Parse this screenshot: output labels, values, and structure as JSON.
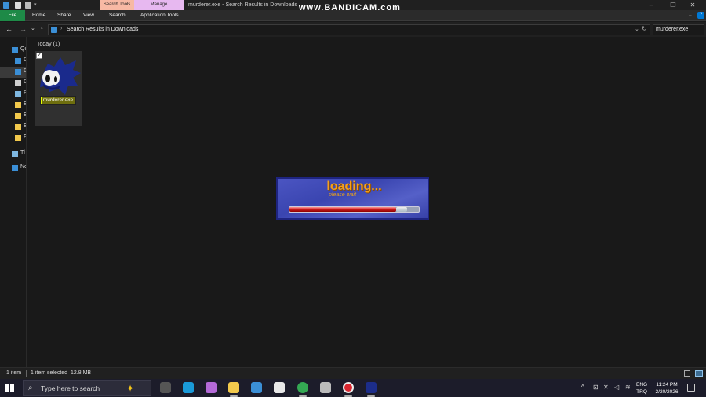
{
  "window": {
    "title": "murderer.exe - Search Results in Downloads",
    "context_tab_search": "Search Tools",
    "context_tab_manage": "Manage",
    "watermark": "www.BANDICAM.com",
    "minimize": "–",
    "maximize": "❐",
    "close": "✕"
  },
  "ribbon": {
    "file": "File",
    "tabs": [
      "Home",
      "Share",
      "View",
      "Search",
      "Application Tools"
    ],
    "collapse": "⌄",
    "help": "?"
  },
  "nav": {
    "back": "←",
    "forward": "→",
    "recent": "⌄",
    "up": "↑",
    "separator": "›",
    "address": "Search Results in Downloads",
    "address_dropdown": "⌄",
    "refresh": "↻",
    "search_value": "murderer.exe"
  },
  "sidebar": {
    "items": [
      {
        "label": "Qu",
        "icon": "star-icon",
        "color": "#3b8fd6"
      },
      {
        "label": "D",
        "icon": "desktop-icon",
        "color": "#3b8fd6"
      },
      {
        "label": "D",
        "icon": "download-icon",
        "color": "#3b8fd6"
      },
      {
        "label": "D",
        "icon": "document-icon",
        "color": "#cfcfcf"
      },
      {
        "label": "P",
        "icon": "pictures-icon",
        "color": "#7eb7e0"
      },
      {
        "label": "E",
        "icon": "folder-icon",
        "color": "#f2c94c"
      },
      {
        "label": "E",
        "icon": "folder-icon",
        "color": "#f2c94c"
      },
      {
        "label": "E",
        "icon": "folder-icon",
        "color": "#f2c94c"
      },
      {
        "label": "F",
        "icon": "folder-icon",
        "color": "#f2c94c"
      },
      {
        "label": "Th",
        "icon": "pc-icon",
        "color": "#7eb7e0"
      },
      {
        "label": "Ne",
        "icon": "network-icon",
        "color": "#3b8fd6"
      }
    ]
  },
  "content": {
    "group_header": "Today (1)",
    "file_name": "murderer.exe",
    "check": "✓"
  },
  "loading": {
    "title": "loading...",
    "subtitle": "please wait",
    "progress": 0.9
  },
  "status": {
    "items": "1 item",
    "selected": "1 item selected",
    "size": "12.8 MB"
  },
  "taskbar": {
    "search_placeholder": "Type here to search",
    "copilot": "✦",
    "apps": [
      {
        "name": "task-view-icon",
        "color": "#555"
      },
      {
        "name": "edge-icon",
        "color": "#1a9ad9"
      },
      {
        "name": "copilot-app-icon",
        "color": "#b46ad8"
      },
      {
        "name": "file-explorer-icon",
        "color": "#f2c94c"
      },
      {
        "name": "mail-icon",
        "color": "#3b8fd6"
      },
      {
        "name": "store-icon",
        "color": "#e8e8e8"
      },
      {
        "name": "chrome-icon",
        "color": "#34a853"
      },
      {
        "name": "printer-icon",
        "color": "#bbbbbb"
      },
      {
        "name": "bandicam-icon",
        "color": "#d9262f"
      },
      {
        "name": "murderer-app-icon",
        "color": "#1c2d8a"
      }
    ],
    "tray_chevron": "^",
    "lang_line1": "ENG",
    "lang_line2": "TRQ",
    "time": "11:24 PM",
    "date": "2/20/2026"
  },
  "colors": {
    "accent": "#0078d4",
    "file_tab": "#1e8a47",
    "search_tools_tab": "#f7b9a4",
    "manage_tab": "#e7b8f0",
    "loading_title": "#f5a01a"
  }
}
